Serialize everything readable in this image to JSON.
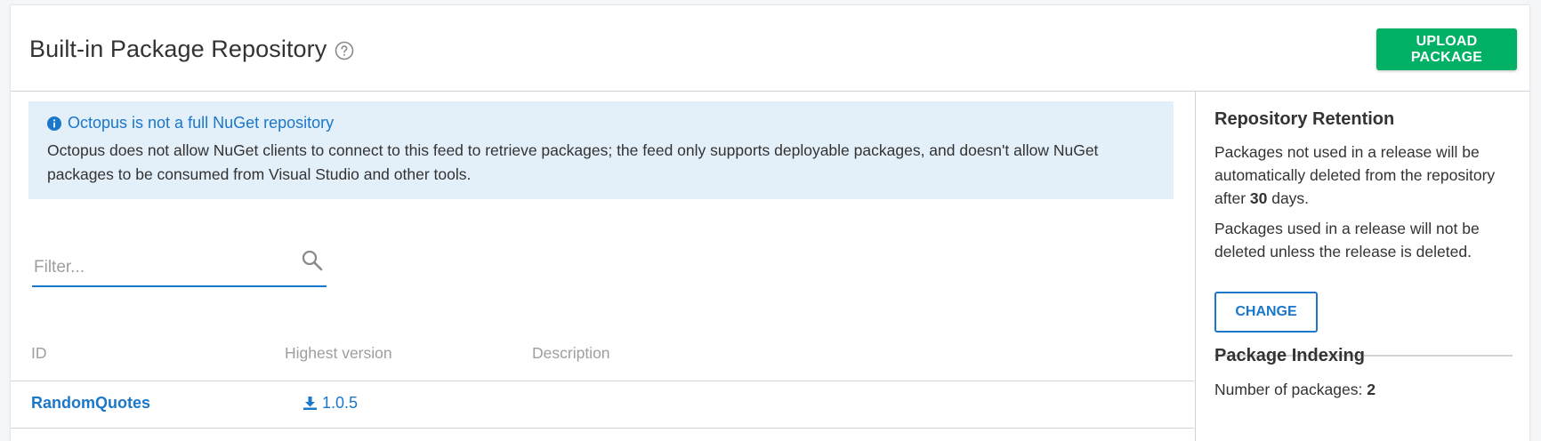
{
  "header": {
    "title": "Built-in Package Repository",
    "upload_label": "UPLOAD PACKAGE"
  },
  "callout": {
    "title": "Octopus is not a full NuGet repository",
    "body": "Octopus does not allow NuGet clients to connect to this feed to retrieve packages; the feed only supports deployable packages, and doesn't allow NuGet packages to be consumed from Visual Studio and other tools."
  },
  "filter": {
    "placeholder": "Filter...",
    "value": ""
  },
  "table": {
    "columns": [
      "ID",
      "Highest version",
      "Description"
    ],
    "rows": [
      {
        "id": "RandomQuotes",
        "version": "1.0.5",
        "description": ""
      }
    ]
  },
  "sidebar": {
    "retention": {
      "heading": "Repository Retention",
      "text_before": "Packages not used in a release will be automatically deleted from the repository after ",
      "days": "30",
      "text_after": " days.",
      "text2": "Packages used in a release will not be deleted unless the release is deleted.",
      "change_label": "CHANGE"
    },
    "indexing": {
      "heading": "Package Indexing",
      "count_label": "Number of packages: ",
      "count": "2"
    }
  },
  "colors": {
    "accent": "#1a77ca",
    "primary_button": "#00b065",
    "callout_bg": "#e3eff9"
  }
}
